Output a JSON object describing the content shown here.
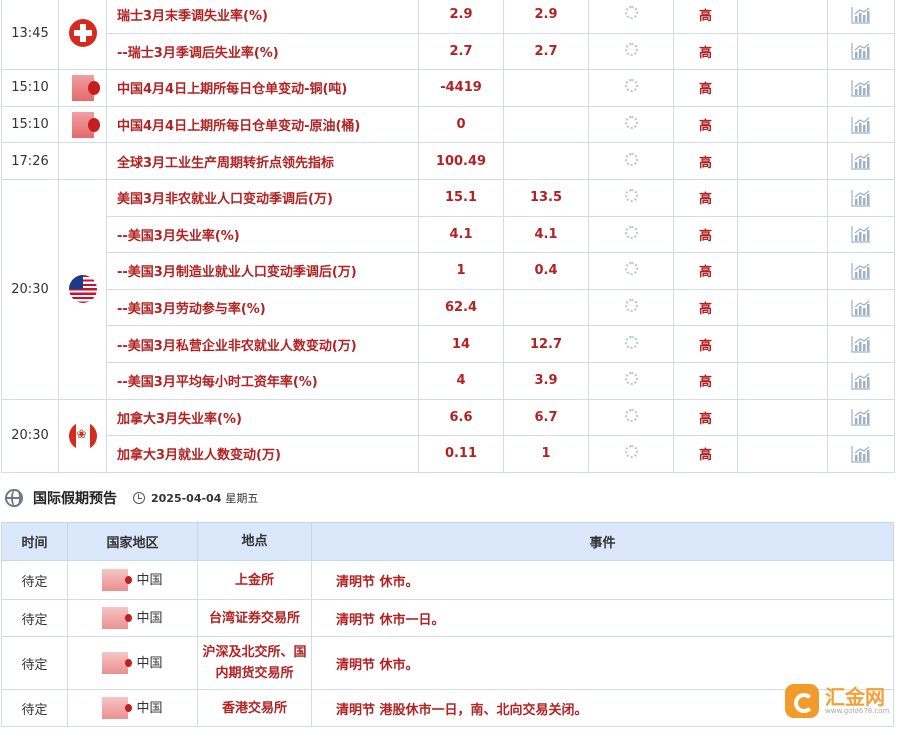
{
  "economic_events": [
    {
      "time": "13:45",
      "flag": "switzerland-flag-icon",
      "name": "瑞士3月末季调失业率(%)",
      "previous": "2.9",
      "forecast": "2.9",
      "importance": "高"
    },
    {
      "time": "",
      "flag": "",
      "name": "--瑞士3月季调后失业率(%)",
      "previous": "2.7",
      "forecast": "2.7",
      "importance": "高"
    },
    {
      "time": "15:10",
      "flag": "blurred-flag-icon",
      "name": "中国4月4日上期所每日仓单变动-铜(吨)",
      "previous": "-4419",
      "forecast": "",
      "importance": "高"
    },
    {
      "time": "15:10",
      "flag": "blurred-flag-icon",
      "name": "中国4月4日上期所每日仓单变动-原油(桶)",
      "previous": "0",
      "forecast": "",
      "importance": "高"
    },
    {
      "time": "17:26",
      "flag": "",
      "name": "全球3月工业生产周期转折点领先指标",
      "previous": "100.49",
      "forecast": "",
      "importance": "高"
    },
    {
      "time": "20:30",
      "flag": "us-flag-icon",
      "name": "美国3月非农就业人口变动季调后(万)",
      "previous": "15.1",
      "forecast": "13.5",
      "importance": "高"
    },
    {
      "time": "",
      "flag": "",
      "name": "--美国3月失业率(%)",
      "previous": "4.1",
      "forecast": "4.1",
      "importance": "高"
    },
    {
      "time": "",
      "flag": "",
      "name": "--美国3月制造业就业人口变动季调后(万)",
      "previous": "1",
      "forecast": "0.4",
      "importance": "高"
    },
    {
      "time": "",
      "flag": "",
      "name": "--美国3月劳动参与率(%)",
      "previous": "62.4",
      "forecast": "",
      "importance": "高"
    },
    {
      "time": "",
      "flag": "",
      "name": "--美国3月私营企业非农就业人数变动(万)",
      "previous": "14",
      "forecast": "12.7",
      "importance": "高"
    },
    {
      "time": "",
      "flag": "",
      "name": "--美国3月平均每小时工资年率(%)",
      "previous": "4",
      "forecast": "3.9",
      "importance": "高"
    },
    {
      "time": "20:30",
      "flag": "canada-flag-icon",
      "name": "加拿大3月失业率(%)",
      "previous": "6.6",
      "forecast": "6.7",
      "importance": "高"
    },
    {
      "time": "",
      "flag": "",
      "name": "加拿大3月就业人数变动(万)",
      "previous": "0.11",
      "forecast": "1",
      "importance": "高"
    }
  ],
  "holiday": {
    "title": "国际假期预告",
    "date": "2025-04-04",
    "weekday": "星期五",
    "headers": {
      "time": "时间",
      "region": "国家地区",
      "place": "地点",
      "event": "事件"
    },
    "rows": [
      {
        "time": "待定",
        "region": "中国",
        "place": "上金所",
        "event": "清明节 休市。"
      },
      {
        "time": "待定",
        "region": "中国",
        "place": "台湾证券交易所",
        "event": "清明节 休市一日。"
      },
      {
        "time": "待定",
        "region": "中国",
        "place": "沪深及北交所、国内期货交易所",
        "event": "清明节 休市。"
      },
      {
        "time": "待定",
        "region": "中国",
        "place": "香港交易所",
        "event": "清明节 港股休市一日，南、北向交易关闭。"
      }
    ]
  },
  "watermark": {
    "name": "汇金网",
    "url": "www.gold678.com"
  },
  "colors": {
    "accent": "#b22222",
    "header_bg": "#dbe7fa",
    "border": "#d3dce6",
    "brand": "#f39b2a"
  }
}
